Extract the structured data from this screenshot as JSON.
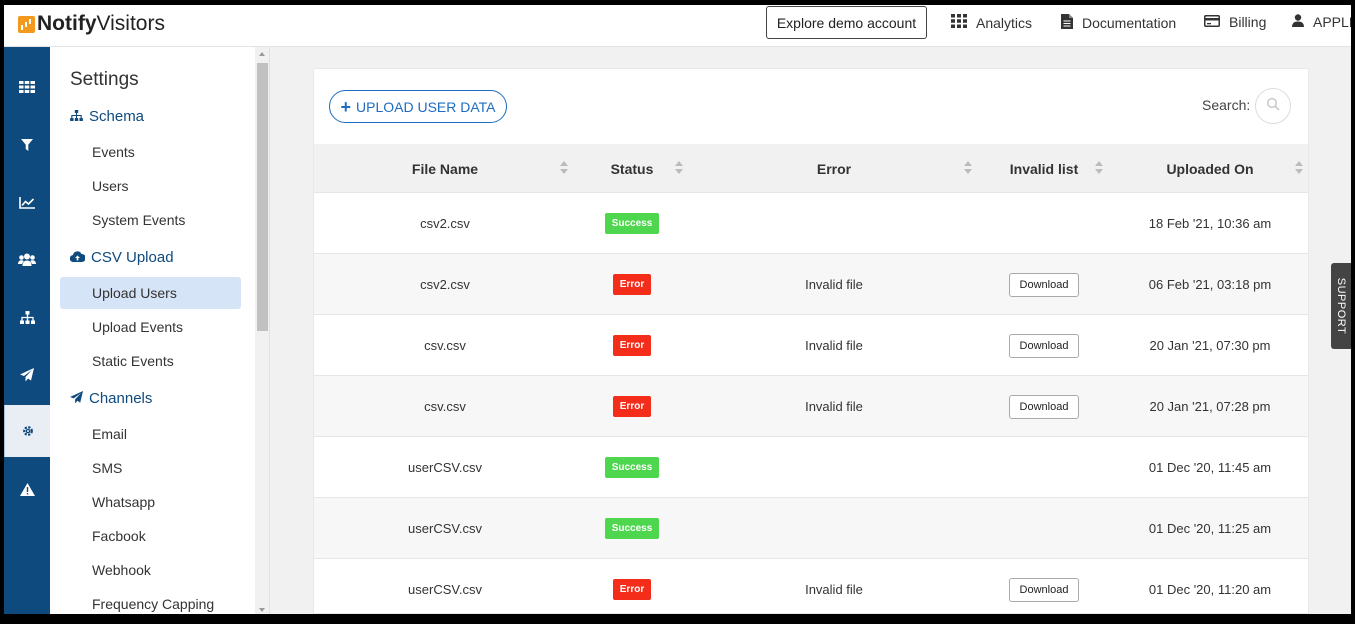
{
  "header": {
    "logo_bold": "Notify",
    "logo_thin": "Visitors",
    "demo_button": "Explore demo account",
    "nav": [
      {
        "label": "Analytics",
        "icon": "grid-icon"
      },
      {
        "label": "Documentation",
        "icon": "document-icon"
      },
      {
        "label": "Billing",
        "icon": "credit-card-icon"
      },
      {
        "label": "APPLI",
        "icon": "user-icon"
      }
    ]
  },
  "rail": {
    "items": [
      "dashboard-grid-icon",
      "filter-icon",
      "line-chart-icon",
      "users-icon",
      "sitemap-icon",
      "paper-plane-icon",
      "gear-icon",
      "warning-icon"
    ],
    "active": "gear-icon"
  },
  "sidebar": {
    "title": "Settings",
    "schema": {
      "label": "Schema",
      "items": [
        "Events",
        "Users",
        "System Events"
      ]
    },
    "csv": {
      "label": "CSV Upload",
      "items": [
        "Upload Users",
        "Upload Events",
        "Static Events"
      ]
    },
    "channels": {
      "label": "Channels",
      "items": [
        "Email",
        "SMS",
        "Whatsapp",
        "Facbook",
        "Webhook",
        "Frequency Capping"
      ]
    },
    "active_item": "Upload Users"
  },
  "main": {
    "upload_button": "UPLOAD USER DATA",
    "search_label": "Search:",
    "columns": [
      "File Name",
      "Status",
      "Error",
      "Invalid list",
      "Uploaded On"
    ],
    "rows": [
      {
        "file": "csv2.csv",
        "status": "Success",
        "error": "",
        "invalid": "",
        "uploaded": "18 Feb '21, 10:36 am"
      },
      {
        "file": "csv2.csv",
        "status": "Error",
        "error": "Invalid file",
        "invalid": "Download",
        "uploaded": "06 Feb '21, 03:18 pm"
      },
      {
        "file": "csv.csv",
        "status": "Error",
        "error": "Invalid file",
        "invalid": "Download",
        "uploaded": "20 Jan '21, 07:30 pm"
      },
      {
        "file": "csv.csv",
        "status": "Error",
        "error": "Invalid file",
        "invalid": "Download",
        "uploaded": "20 Jan '21, 07:28 pm"
      },
      {
        "file": "userCSV.csv",
        "status": "Success",
        "error": "",
        "invalid": "",
        "uploaded": "01 Dec '20, 11:45 am"
      },
      {
        "file": "userCSV.csv",
        "status": "Success",
        "error": "",
        "invalid": "",
        "uploaded": "01 Dec '20, 11:25 am"
      },
      {
        "file": "userCSV.csv",
        "status": "Error",
        "error": "Invalid file",
        "invalid": "Download",
        "uploaded": "01 Dec '20, 11:20 am"
      }
    ]
  },
  "support_tab": "SUPPORT",
  "colors": {
    "brand": "#0e4a7e",
    "accent": "#1f6cc2",
    "success": "#4ed64e",
    "error": "#f42c1a",
    "logo": "#f39a1e"
  }
}
